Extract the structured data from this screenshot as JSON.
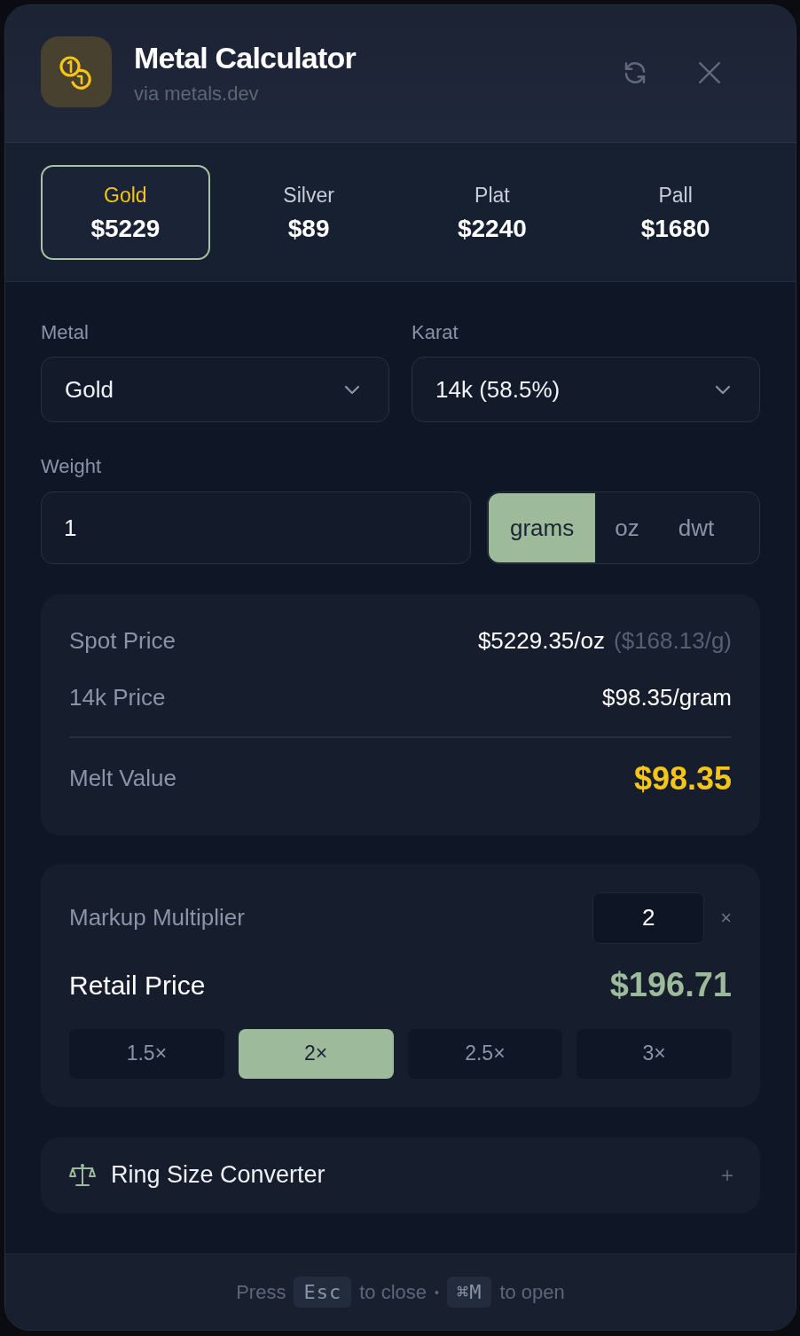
{
  "header": {
    "title": "Metal Calculator",
    "subtitle": "via metals.dev"
  },
  "metal_tabs": [
    {
      "label": "Gold",
      "price": "$5229",
      "selected": true
    },
    {
      "label": "Silver",
      "price": "$89",
      "selected": false
    },
    {
      "label": "Plat",
      "price": "$2240",
      "selected": false
    },
    {
      "label": "Pall",
      "price": "$1680",
      "selected": false
    }
  ],
  "selects": [
    {
      "label": "Metal",
      "value": "Gold"
    },
    {
      "label": "Karat",
      "value": "14k (58.5%)"
    }
  ],
  "weight": {
    "label": "Weight",
    "value": "1",
    "units": [
      {
        "label": "grams",
        "selected": true
      },
      {
        "label": "oz",
        "selected": false
      },
      {
        "label": "dwt",
        "selected": false
      }
    ]
  },
  "price_summary": {
    "rows": [
      {
        "label": "Spot Price",
        "value": "$5229.35/oz",
        "note": "($168.13/g)"
      },
      {
        "label": "14k Price",
        "value": "$98.35/gram"
      }
    ],
    "total": {
      "label": "Melt Value",
      "value": "$98.35"
    }
  },
  "markup": {
    "label": "Markup Multiplier",
    "value": "2",
    "unit": "×",
    "result_label": "Retail Price",
    "result_value": "$196.71",
    "presets": [
      {
        "label": "1.5×",
        "selected": false
      },
      {
        "label": "2×",
        "selected": true
      },
      {
        "label": "2.5×",
        "selected": false
      },
      {
        "label": "3×",
        "selected": false
      }
    ]
  },
  "ring_size": {
    "label": "Ring Size Converter",
    "toggle": "+"
  },
  "footer": [
    {
      "kind": "text",
      "text": "Press"
    },
    {
      "kind": "key",
      "text": "Esc"
    },
    {
      "kind": "text",
      "text": "to close"
    },
    {
      "kind": "separator",
      "text": "•"
    },
    {
      "kind": "key",
      "text": "⌘M"
    },
    {
      "kind": "text",
      "text": "to open"
    }
  ]
}
